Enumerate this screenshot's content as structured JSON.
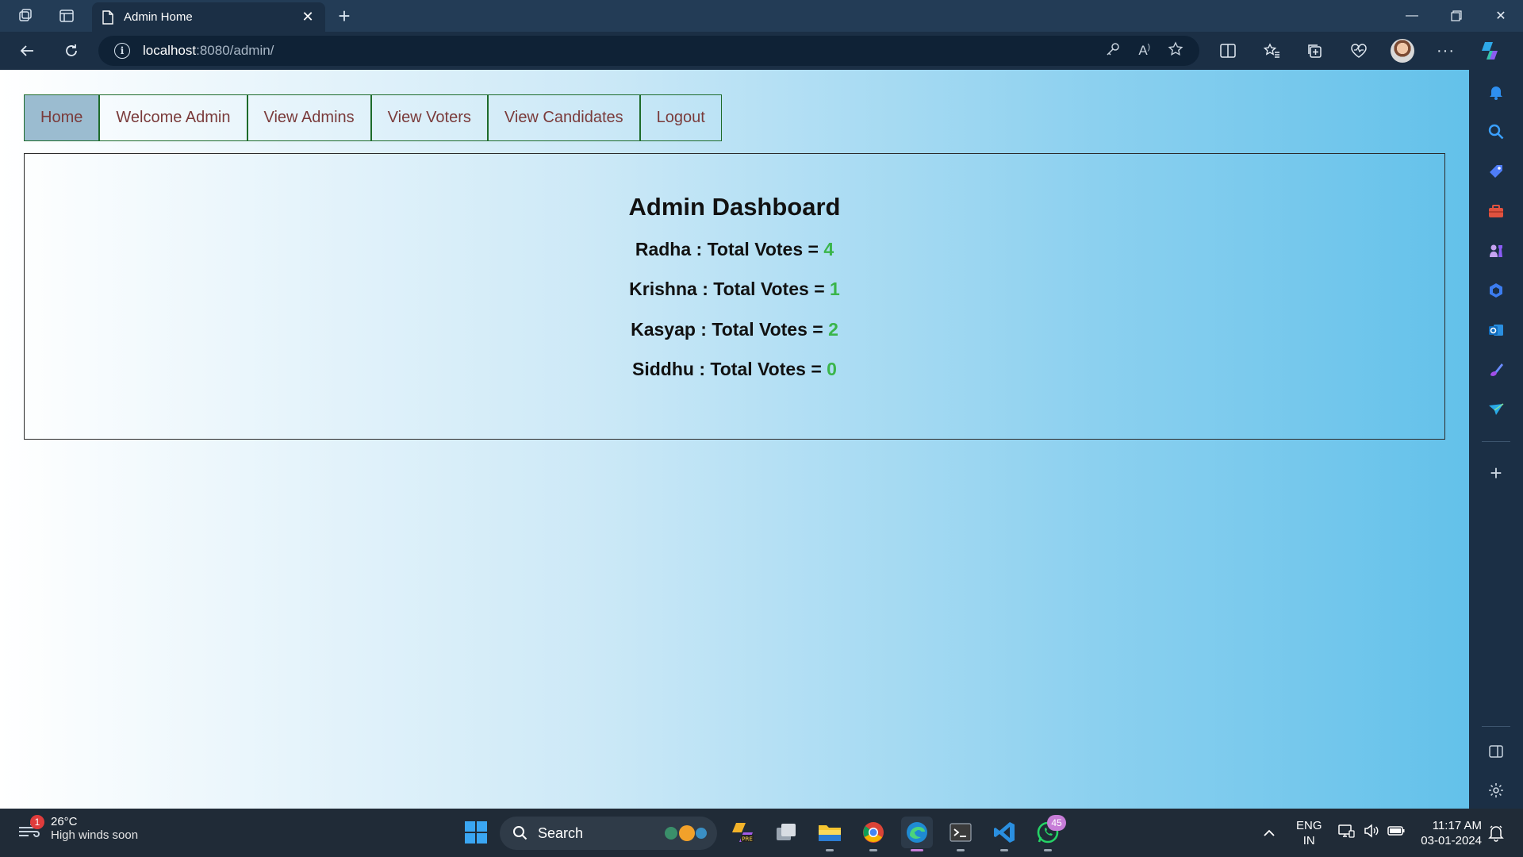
{
  "browser": {
    "tab_title": "Admin Home",
    "url_host": "localhost",
    "url_rest": ":8080/admin/"
  },
  "nav": {
    "items": [
      {
        "label": "Home",
        "active": true
      },
      {
        "label": "Welcome Admin",
        "active": false
      },
      {
        "label": "View Admins",
        "active": false
      },
      {
        "label": "View Voters",
        "active": false
      },
      {
        "label": "View Candidates",
        "active": false
      },
      {
        "label": "Logout",
        "active": false
      }
    ]
  },
  "dashboard": {
    "title": "Admin Dashboard",
    "results": [
      {
        "name": "Radha",
        "label": " : Total Votes = ",
        "count": "4"
      },
      {
        "name": "Krishna",
        "label": " : Total Votes = ",
        "count": "1"
      },
      {
        "name": "Kasyap",
        "label": " : Total Votes = ",
        "count": "2"
      },
      {
        "name": "Siddhu",
        "label": " : Total Votes = ",
        "count": "0"
      }
    ],
    "count_color": "#3ab54a"
  },
  "taskbar": {
    "weather_temp": "26°C",
    "weather_desc": "High winds soon",
    "weather_badge": "1",
    "search_label": "Search",
    "whatsapp_badge": "45",
    "lang_line1": "ENG",
    "lang_line2": "IN",
    "time": "11:17 AM",
    "date": "03-01-2024"
  }
}
